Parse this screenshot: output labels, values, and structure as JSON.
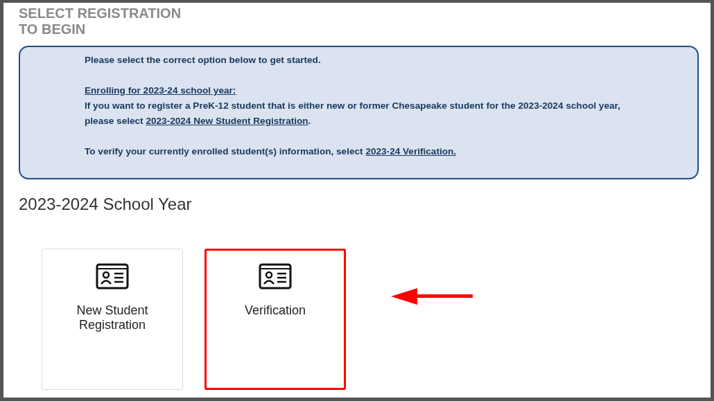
{
  "title": "SELECT REGISTRATION\nTO BEGIN",
  "notice": {
    "blocks": [
      {
        "lines": [
          [
            {
              "kind": "text",
              "text": "Please select the correct option below to get started."
            }
          ]
        ]
      },
      {
        "lines": [
          [
            {
              "kind": "link",
              "text": "Enrolling for 2023-24 school year:"
            }
          ],
          [
            {
              "kind": "text",
              "text": "If you want to register a PreK-12 student that is either new or former Chesapeake student for the 2023-2024 school year, please select "
            },
            {
              "kind": "link",
              "text": "2023-2024 New Student Registration"
            },
            {
              "kind": "text",
              "text": "."
            }
          ]
        ]
      },
      {
        "lines": [
          [
            {
              "kind": "text",
              "text": "To verify your currently enrolled student(s) information, select "
            },
            {
              "kind": "link",
              "text": "2023-24 Verification."
            }
          ]
        ]
      }
    ]
  },
  "section_heading": "2023-2024 School Year",
  "cards": [
    {
      "label": "New Student\nRegistration",
      "highlighted": false
    },
    {
      "label": "Verification",
      "highlighted": true
    }
  ]
}
